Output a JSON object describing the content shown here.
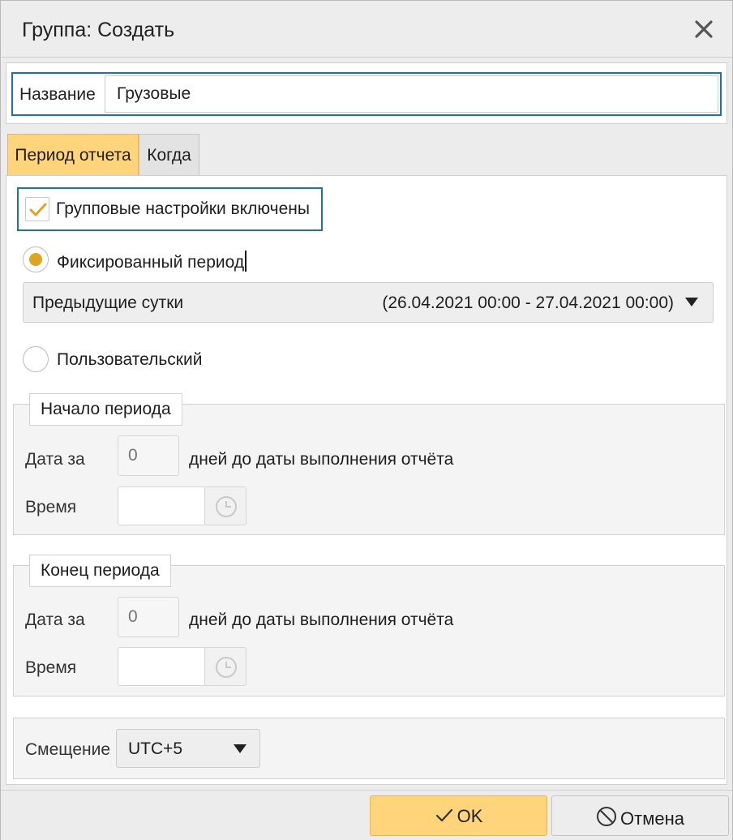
{
  "window": {
    "title": "Группа: Создать",
    "close_icon": "close-icon"
  },
  "name": {
    "label": "Название",
    "value": "Грузовые"
  },
  "tabs": [
    {
      "label": "Период отчета",
      "active": true
    },
    {
      "label": "Когда",
      "active": false
    }
  ],
  "group_settings": {
    "label": "Групповые настройки включены",
    "checked": true
  },
  "fixed_period": {
    "label": "Фиксированный период",
    "selected": true,
    "select_value": "Предыдущие сутки",
    "select_range": "(26.04.2021 00:00 - 27.04.2021 00:00)"
  },
  "custom_period": {
    "label": "Пользовательский",
    "selected": false
  },
  "period_start": {
    "legend": "Начало периода",
    "date_label": "Дата за",
    "days_placeholder": "0",
    "days_text": "дней до даты выполнения отчёта",
    "time_label": "Время"
  },
  "period_end": {
    "legend": "Конец периода",
    "date_label": "Дата за",
    "days_placeholder": "0",
    "days_text": "дней до даты выполнения отчёта",
    "time_label": "Время"
  },
  "offset": {
    "label": "Смещение",
    "value": "UTC+5"
  },
  "buttons": {
    "ok": "OK",
    "cancel": "Отмена"
  },
  "colors": {
    "accent": "#ffd47b",
    "focus": "#1f6fb5",
    "radio": "#e0a51e"
  }
}
